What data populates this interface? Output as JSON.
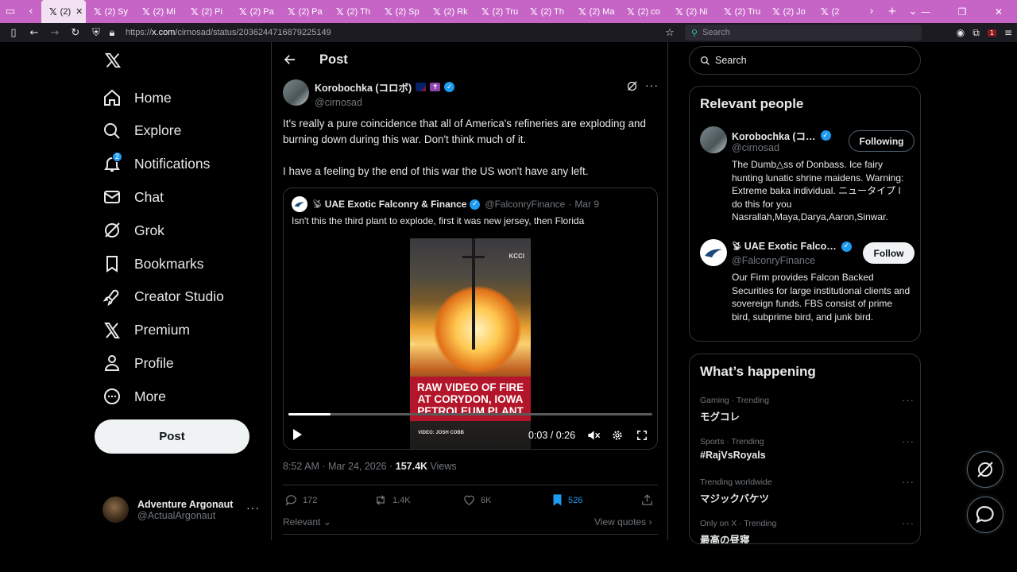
{
  "browser": {
    "tabs": [
      {
        "label": "(2)",
        "active": true
      },
      {
        "label": "(2) Sy"
      },
      {
        "label": "(2) Mi"
      },
      {
        "label": "(2) Pi"
      },
      {
        "label": "(2) Pa"
      },
      {
        "label": "(2) Pa"
      },
      {
        "label": "(2) Th"
      },
      {
        "label": "(2) Sp"
      },
      {
        "label": "(2) Rk"
      },
      {
        "label": "(2) Tru"
      },
      {
        "label": "(2) Th"
      },
      {
        "label": "(2) Ma"
      },
      {
        "label": "(2) co"
      },
      {
        "label": "(2) Ni"
      },
      {
        "label": "(2) Tru"
      },
      {
        "label": "(2) Jo"
      },
      {
        "label": "(2"
      }
    ],
    "url_scheme": "https://",
    "url_host": "x.com",
    "url_path": "/cirnosad/status/2036244716879225149",
    "search_placeholder": "Search",
    "ext_badge": "1"
  },
  "nav": {
    "items": [
      {
        "label": "Home",
        "icon": "home-icon"
      },
      {
        "label": "Explore",
        "icon": "search-icon"
      },
      {
        "label": "Notifications",
        "icon": "bell-icon",
        "badge": "2"
      },
      {
        "label": "Chat",
        "icon": "mail-icon"
      },
      {
        "label": "Grok",
        "icon": "grok-icon"
      },
      {
        "label": "Bookmarks",
        "icon": "bookmark-icon"
      },
      {
        "label": "Creator Studio",
        "icon": "rocket-icon"
      },
      {
        "label": "Premium",
        "icon": "x-icon"
      },
      {
        "label": "Profile",
        "icon": "person-icon"
      },
      {
        "label": "More",
        "icon": "more-circle-icon"
      }
    ],
    "post_button": "Post",
    "account": {
      "name": "Adventure Argonaut",
      "handle": "@ActualArgonaut"
    }
  },
  "post": {
    "header_title": "Post",
    "author": {
      "name": "Korobochka (コロボ)",
      "handle": "@cirnosad"
    },
    "paragraphs": [
      "It's really a pure coincidence that all of America's refineries are exploding and burning down during this war. Don't think much of it.",
      "I have a feeling by the end of this war the US won't have any left."
    ],
    "quote": {
      "name": "UAE Exotic Falconry & Finance",
      "handle": "@FalconryFinance",
      "date": "Mar 9",
      "text": "Isn't this the third plant to explode, first it was new jersey, then Florida",
      "video": {
        "caption": "RAW VIDEO OF FIRE AT CORYDON, IOWA PETROLEUM PLANT",
        "credit": "VIDEO: JOSH COBB",
        "watermark": "KCCI",
        "time": "0:03 / 0:26",
        "progress": 0.115
      }
    },
    "timestamp": "8:52 AM · Mar 24, 2026 ·",
    "views_count": "157.4K",
    "views_label": "Views",
    "stats": {
      "replies": "172",
      "reposts": "1.4K",
      "likes": "6K",
      "bookmarks": "526"
    },
    "sort_label": "Relevant",
    "view_quotes": "View quotes"
  },
  "sidebar": {
    "search_placeholder": "Search",
    "people_title": "Relevant people",
    "people": [
      {
        "name": "Korobochka (コ…",
        "handle": "@cirnosad",
        "button": "Following",
        "bio": "The Dumb△ss of Donbass. Ice fairy hunting lunatic shrine maidens. Warning: Extreme baka individual. ニュータイプ I do this for you Nasrallah,Maya,Darya,Aaron,Sinwar."
      },
      {
        "name": "UAE Exotic Falco…",
        "handle": "@FalconryFinance",
        "button": "Follow",
        "bio": "Our Firm provides Falcon Backed Securities for large institutional clients and sovereign funds. FBS consist of prime bird, subprime bird, and junk bird."
      }
    ],
    "happening_title": "What’s happening",
    "trends": [
      {
        "context": "Gaming · Trending",
        "name": "モグコレ"
      },
      {
        "context": "Sports · Trending",
        "name": "#RajVsRoyals"
      },
      {
        "context": "Trending worldwide",
        "name": "マジックバケツ"
      },
      {
        "context": "Only on X · Trending",
        "name": "最高の昼寝"
      }
    ]
  },
  "colors": {
    "accent": "#1d9bf0",
    "tabbar": "#c765c7"
  }
}
